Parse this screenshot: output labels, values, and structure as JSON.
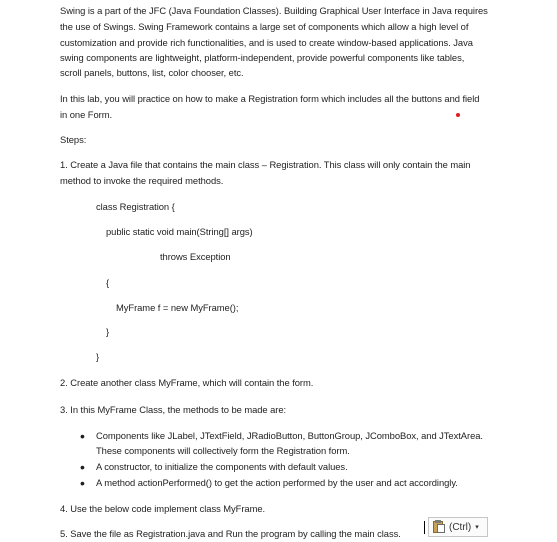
{
  "intro_lines": [
    "Swing is a part of the JFC (Java Foundation Classes). Building Graphical User Interface in Java requires",
    "the use of Swings. Swing Framework contains a large set of components which allow a high level of",
    "customization and provide rich functionalities, and is used to create window-based applications. Java",
    "swing components are lightweight, platform-independent, provide powerful components like tables,",
    "scroll panels, buttons, list, color chooser, etc."
  ],
  "lab_lines": [
    "In this lab, you will practice on how to make a Registration form which includes all the buttons and field",
    "in one Form."
  ],
  "steps_heading": "Steps:",
  "step1_lines": [
    "1. Create a Java file that contains the main class – Registration. This class will only contain the main",
    "method to invoke the required methods."
  ],
  "code": {
    "class_decl": "class Registration {",
    "method_decl": "public static void main(String[] args)",
    "throws": "throws Exception",
    "open_brace": "{",
    "stmt": "MyFrame f = new MyFrame();",
    "close_inner": "}",
    "close_outer": "}"
  },
  "step2": "2. Create another class MyFrame, which will contain the form.",
  "step3": "3. In this MyFrame Class, the methods to be made are:",
  "bullets": {
    "b1_line1": "Components like JLabel, JTextField, JRadioButton, ButtonGroup, JComboBox, and JTextArea.",
    "b1_line2": "These components will collectively form the Registration form.",
    "b2": "A constructor, to initialize the components with default values.",
    "b3": "A method actionPerformed() to get the action performed by the user and act accordingly.",
    "glyph": "•"
  },
  "step4": "4. Use the below code implement class MyFrame.",
  "step5": "5. Save the file as Registration.java and Run the program by calling the main class.",
  "paste_options": {
    "label": "(Ctrl)",
    "icon": "clipboard-icon",
    "caret": "▾"
  }
}
